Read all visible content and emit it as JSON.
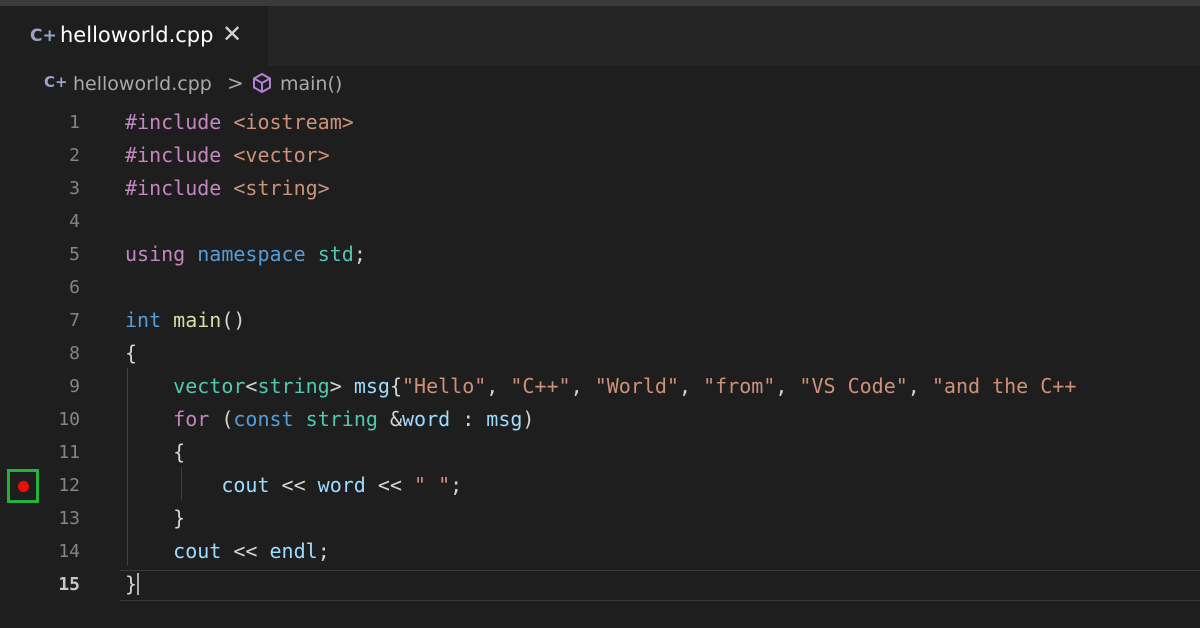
{
  "tab": {
    "icon": "C+",
    "label": "helloworld.cpp",
    "close": "✕"
  },
  "breadcrumb": {
    "file": "helloworld.cpp",
    "separator": ">",
    "symbol": "main()"
  },
  "gutter": {
    "breakpoint_line": 12,
    "active_line": 15
  },
  "colors": {
    "breakpoint": "#e51400",
    "highlight": "#21b33b"
  },
  "lines": [
    {
      "n": "1",
      "tokens": [
        [
          "kw-dir",
          "#include"
        ],
        [
          "pun",
          " "
        ],
        [
          "inc",
          "<iostream>"
        ]
      ]
    },
    {
      "n": "2",
      "tokens": [
        [
          "kw-dir",
          "#include"
        ],
        [
          "pun",
          " "
        ],
        [
          "inc",
          "<vector>"
        ]
      ]
    },
    {
      "n": "3",
      "tokens": [
        [
          "kw-dir",
          "#include"
        ],
        [
          "pun",
          " "
        ],
        [
          "inc",
          "<string>"
        ]
      ]
    },
    {
      "n": "4",
      "tokens": []
    },
    {
      "n": "5",
      "tokens": [
        [
          "ctl",
          "using"
        ],
        [
          "pun",
          " "
        ],
        [
          "kw",
          "namespace"
        ],
        [
          "pun",
          " "
        ],
        [
          "ty",
          "std"
        ],
        [
          "pun",
          ";"
        ]
      ]
    },
    {
      "n": "6",
      "tokens": []
    },
    {
      "n": "7",
      "tokens": [
        [
          "kw",
          "int"
        ],
        [
          "pun",
          " "
        ],
        [
          "fn",
          "main"
        ],
        [
          "pun",
          "()"
        ]
      ]
    },
    {
      "n": "8",
      "tokens": [
        [
          "pun",
          "{"
        ]
      ]
    },
    {
      "n": "9",
      "tokens": [
        [
          "pun",
          "    "
        ],
        [
          "ty",
          "vector"
        ],
        [
          "pun",
          "<"
        ],
        [
          "ty",
          "string"
        ],
        [
          "pun",
          "> "
        ],
        [
          "var",
          "msg"
        ],
        [
          "pun",
          "{"
        ],
        [
          "str",
          "\"Hello\""
        ],
        [
          "pun",
          ", "
        ],
        [
          "str",
          "\"C++\""
        ],
        [
          "pun",
          ", "
        ],
        [
          "str",
          "\"World\""
        ],
        [
          "pun",
          ", "
        ],
        [
          "str",
          "\"from\""
        ],
        [
          "pun",
          ", "
        ],
        [
          "str",
          "\"VS Code\""
        ],
        [
          "pun",
          ", "
        ],
        [
          "str",
          "\"and the C++"
        ]
      ]
    },
    {
      "n": "10",
      "tokens": [
        [
          "pun",
          "    "
        ],
        [
          "ctl",
          "for"
        ],
        [
          "pun",
          " ("
        ],
        [
          "kw",
          "const"
        ],
        [
          "pun",
          " "
        ],
        [
          "ty",
          "string"
        ],
        [
          "pun",
          " &"
        ],
        [
          "var",
          "word"
        ],
        [
          "pun",
          " : "
        ],
        [
          "var",
          "msg"
        ],
        [
          "pun",
          ")"
        ]
      ]
    },
    {
      "n": "11",
      "tokens": [
        [
          "pun",
          "    {"
        ]
      ]
    },
    {
      "n": "12",
      "tokens": [
        [
          "pun",
          "        "
        ],
        [
          "var",
          "cout"
        ],
        [
          "pun",
          " << "
        ],
        [
          "var",
          "word"
        ],
        [
          "pun",
          " << "
        ],
        [
          "str",
          "\" \""
        ],
        [
          "pun",
          ";"
        ]
      ]
    },
    {
      "n": "13",
      "tokens": [
        [
          "pun",
          "    }"
        ]
      ]
    },
    {
      "n": "14",
      "tokens": [
        [
          "pun",
          "    "
        ],
        [
          "var",
          "cout"
        ],
        [
          "pun",
          " << "
        ],
        [
          "var",
          "endl"
        ],
        [
          "pun",
          ";"
        ]
      ]
    },
    {
      "n": "15",
      "tokens": [
        [
          "pun",
          "}"
        ]
      ]
    }
  ]
}
